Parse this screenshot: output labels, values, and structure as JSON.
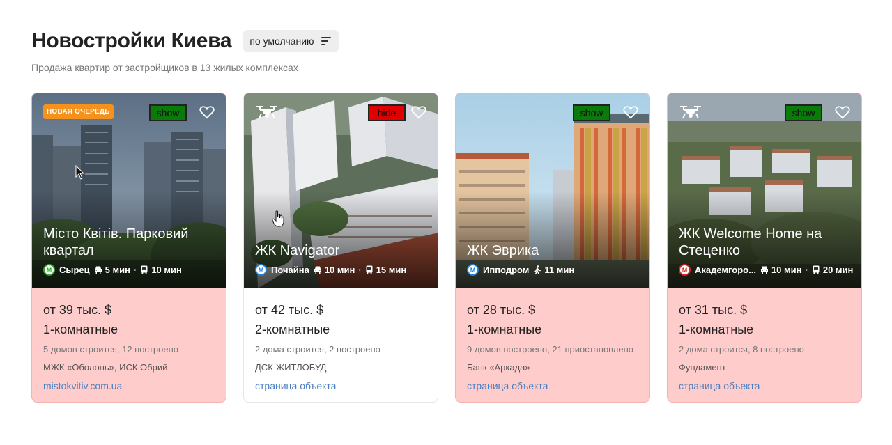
{
  "page": {
    "title": "Новостройки Киева",
    "sort_label": "по умолчанию",
    "subtitle": "Продажа квартир от застройщиков в 13 жилых комплексах"
  },
  "colors": {
    "card_highlight": "#ffcccc",
    "badge_new": "#f5921e",
    "show_button": "#0a7a0a",
    "hide_button": "#e10000",
    "link": "#4a7fc0",
    "metro_green": "#2aa52a",
    "metro_blue": "#1e7fd6",
    "metro_red": "#d9241c"
  },
  "cards": [
    {
      "badge": "НОВАЯ ОЧЕРЕДЬ",
      "toggle": "show",
      "name": "Місто Квітів. Парковий квартал",
      "metro_station": "Сырец",
      "metro_line": "green",
      "transit_1": "5 мин",
      "transit_1_mode": "car-icon",
      "transit_2": "10 мин",
      "transit_2_mode": "bus-icon",
      "price": "от 39 тыс. $",
      "rooms": "1-комнатные",
      "status": "5 домов строится, 12 построено",
      "developer": "МЖК «Оболонь», ИСК Обрий",
      "link": "mistokvitiv.com.ua",
      "highlighted": true
    },
    {
      "toggle": "hide",
      "name": "ЖК Navigator",
      "metro_station": "Почайна",
      "metro_line": "blue",
      "transit_1": "10 мин",
      "transit_1_mode": "car-icon",
      "transit_2": "15 мин",
      "transit_2_mode": "bus-icon",
      "price": "от 42 тыс. $",
      "rooms": "2-комнатные",
      "status": "2 дома строится, 2 построено",
      "developer": "ДСК-ЖИТЛОБУД",
      "link": "страница объекта",
      "highlighted": false
    },
    {
      "toggle": "show",
      "name": "ЖК Эврика",
      "metro_station": "Ипподром",
      "metro_line": "blue",
      "transit_1": "11 мин",
      "transit_1_mode": "walk-icon",
      "price": "от 28 тыс. $",
      "rooms": "1-комнатные",
      "status": "9 домов построено, 21 приостановлено",
      "developer": "Банк «Аркада»",
      "link": "страница объекта",
      "highlighted": true
    },
    {
      "toggle": "show",
      "name": "ЖК Welcome Home на Стеценко",
      "metro_station": "Академгоро...",
      "metro_line": "red",
      "transit_1": "10 мин",
      "transit_1_mode": "car-icon",
      "transit_2": "20 мин",
      "transit_2_mode": "bus-icon",
      "price": "от 31 тыс. $",
      "rooms": "1-комнатные",
      "status": "2 дома строится, 8 построено",
      "developer": "Фундамент",
      "link": "страница объекта",
      "highlighted": true
    }
  ]
}
